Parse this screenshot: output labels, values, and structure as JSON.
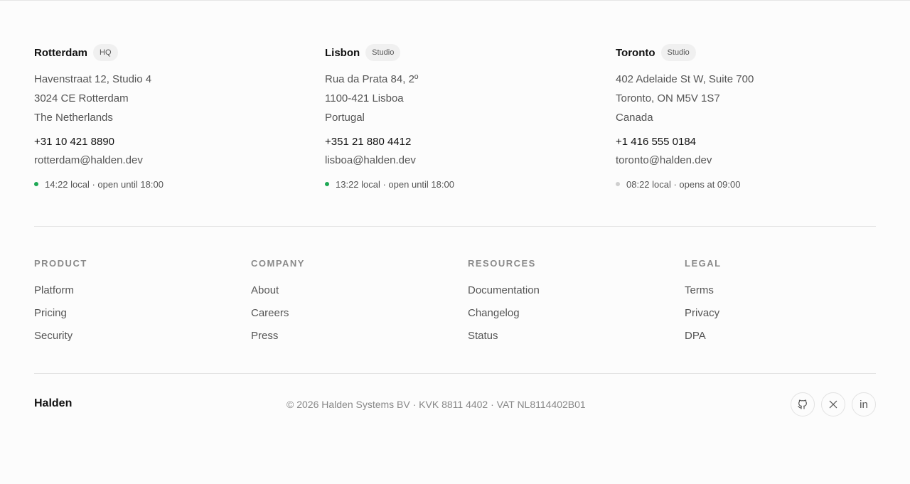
{
  "offices": [
    {
      "city": "Rotterdam",
      "badge": "HQ",
      "address": [
        "Havenstraat 12, Studio 4",
        "3024 CE Rotterdam",
        "The Netherlands"
      ],
      "phone": "+31 10 421 8890",
      "email": "rotterdam@halden.dev",
      "status": "14:22 local · open until 18:00",
      "status_color": "#1fa855"
    },
    {
      "city": "Lisbon",
      "badge": "Studio",
      "address": [
        "Rua da Prata 84, 2º",
        "1100-421 Lisboa",
        "Portugal"
      ],
      "phone": "+351 21 880 4412",
      "email": "lisboa@halden.dev",
      "status": "13:22 local · open until 18:00",
      "status_color": "#1fa855"
    },
    {
      "city": "Toronto",
      "badge": "Studio",
      "address": [
        "402 Adelaide St W, Suite 700",
        "Toronto, ON M5V 1S7",
        "Canada"
      ],
      "phone": "+1 416 555 0184",
      "email": "toronto@halden.dev",
      "status": "08:22 local · opens at 09:00",
      "status_color": "#cfcfcf"
    }
  ],
  "link_columns": [
    {
      "title": "PRODUCT",
      "items": [
        "Platform",
        "Pricing",
        "Security"
      ]
    },
    {
      "title": "COMPANY",
      "items": [
        "About",
        "Careers",
        "Press"
      ]
    },
    {
      "title": "RESOURCES",
      "items": [
        "Documentation",
        "Changelog",
        "Status"
      ]
    },
    {
      "title": "LEGAL",
      "items": [
        "Terms",
        "Privacy",
        "DPA"
      ]
    }
  ],
  "footer": {
    "brand": "Halden",
    "legal": "© 2026 Halden Systems BV · KVK 8811 4402 · VAT NL8114402B01",
    "socials": [
      {
        "icon": "github-icon"
      },
      {
        "icon": "x-icon"
      },
      {
        "icon": "linkedin-icon",
        "text": "in"
      }
    ]
  }
}
